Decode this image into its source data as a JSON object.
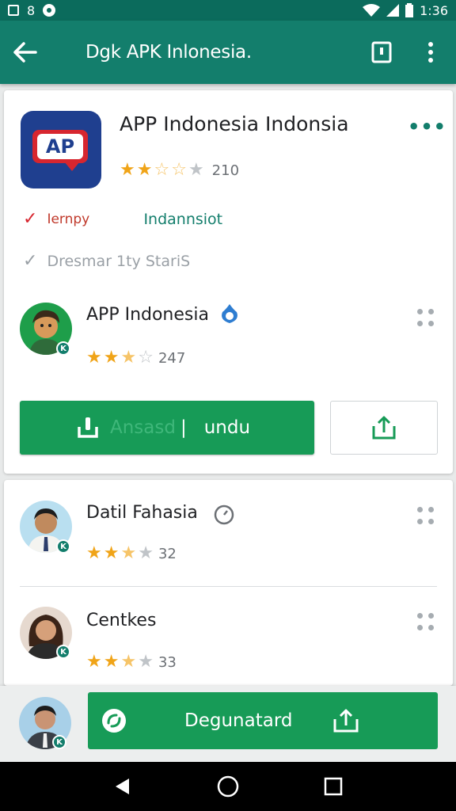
{
  "status_bar": {
    "left_icon_text": "8",
    "time": "1:36"
  },
  "app_bar": {
    "title": "Dgk APK Inlonesia."
  },
  "app": {
    "name": "APP Indonesia Indonsia",
    "icon_text": "AP",
    "rating_value": 2.5,
    "rating_count": "210",
    "tag_1_left": "Iernpy",
    "tag_1_right": "Indannsiot",
    "tag_2": "Dresmar 1ty StariS"
  },
  "developer": {
    "name": "APP Indonesia",
    "rating_value": 2.5,
    "rating_count": "247",
    "badge": "K"
  },
  "actions": {
    "install_faded": "Ansasd",
    "install_label": "undu"
  },
  "list_items": [
    {
      "name": "Datil Fahasia",
      "rating_value": 2.5,
      "rating_count": "32",
      "badge": "K"
    },
    {
      "name": "Centkes",
      "rating_value": 2.5,
      "rating_count": "33",
      "badge": "K"
    }
  ],
  "bottom_bar": {
    "download_label": "Degunatard",
    "badge": "K"
  },
  "colors": {
    "primary": "#137e6c",
    "status_bar": "#0b6b5c",
    "accent_green": "#179b57",
    "star": "#f0a418",
    "brand_blue": "#1f3f8f",
    "brand_red": "#d7262f"
  },
  "icons": [
    "back-arrow-icon",
    "bookmark-icon",
    "overflow-menu-icon",
    "microphone-icon",
    "share-icon",
    "refresh-icon",
    "back-nav-icon",
    "home-nav-icon",
    "recents-nav-icon"
  ]
}
